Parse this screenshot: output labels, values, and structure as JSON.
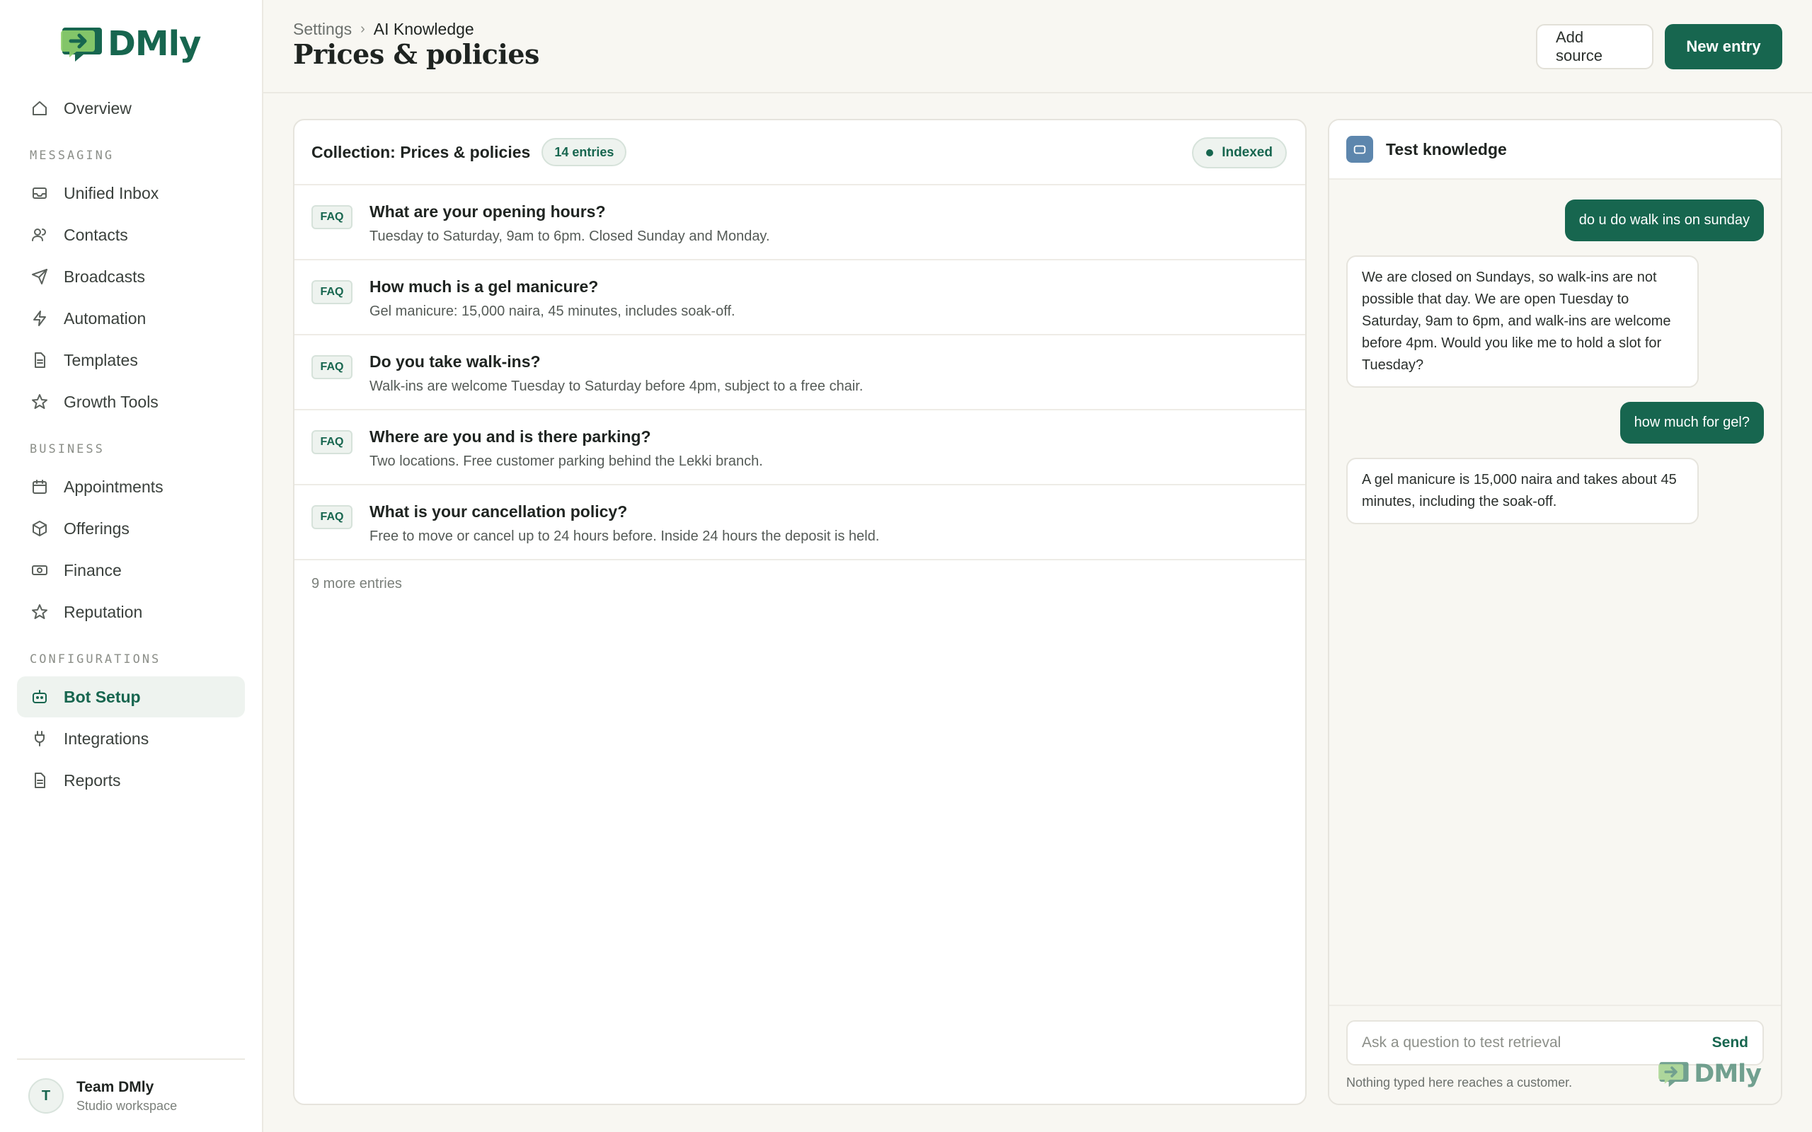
{
  "brand": {
    "name": "DMly"
  },
  "sidebar": {
    "overview": "Overview",
    "sections": {
      "messaging": "MESSAGING",
      "business": "BUSINESS",
      "configurations": "CONFIGURATIONS"
    },
    "messaging_items": [
      "Unified Inbox",
      "Contacts",
      "Broadcasts",
      "Automation",
      "Templates",
      "Growth Tools"
    ],
    "business_items": [
      "Appointments",
      "Offerings",
      "Finance",
      "Reputation"
    ],
    "config_items": [
      "Bot Setup",
      "Integrations",
      "Reports"
    ],
    "active": "Bot Setup",
    "footer": {
      "avatar": "T",
      "name": "Team DMly",
      "subtitle": "Studio workspace"
    }
  },
  "header": {
    "breadcrumb": [
      "Settings",
      "AI Knowledge"
    ],
    "breadcrumb_sep": "›",
    "title": "Prices & policies",
    "add_source": "Add source",
    "new_entry": "New entry"
  },
  "collection": {
    "title": "Collection: Prices & policies",
    "count": "14 entries",
    "status": "Indexed",
    "badge": "FAQ",
    "entries": [
      {
        "q": "What are your opening hours?",
        "a": "Tuesday to Saturday, 9am to 6pm. Closed Sunday and Monday."
      },
      {
        "q": "How much is a gel manicure?",
        "a": "Gel manicure: 15,000 naira, 45 minutes, includes soak-off."
      },
      {
        "q": "Do you take walk-ins?",
        "a": "Walk-ins are welcome Tuesday to Saturday before 4pm, subject to a free chair."
      },
      {
        "q": "Where are you and is there parking?",
        "a": "Two locations. Free customer parking behind the Lekki branch."
      },
      {
        "q": "What is your cancellation policy?",
        "a": "Free to move or cancel up to 24 hours before. Inside 24 hours the deposit is held."
      }
    ],
    "more": "9 more entries"
  },
  "test": {
    "title": "Test knowledge",
    "messages": [
      {
        "role": "user",
        "text": "do u do walk ins on sunday"
      },
      {
        "role": "bot",
        "text": "We are closed on Sundays, so walk-ins are not possible that day. We are open Tuesday to Saturday, 9am to 6pm, and walk-ins are welcome before 4pm. Would you like me to hold a slot for Tuesday?"
      },
      {
        "role": "user",
        "text": "how much for gel?"
      },
      {
        "role": "bot",
        "text": "A gel manicure is 15,000 naira and takes about 45 minutes, including the soak-off."
      }
    ],
    "placeholder": "Ask a question to test retrieval",
    "send": "Send",
    "note": "Nothing typed here reaches a customer."
  },
  "colors": {
    "accent": "#17664f",
    "background": "#f8f7f2",
    "bot_icon": "#5d86ad"
  }
}
